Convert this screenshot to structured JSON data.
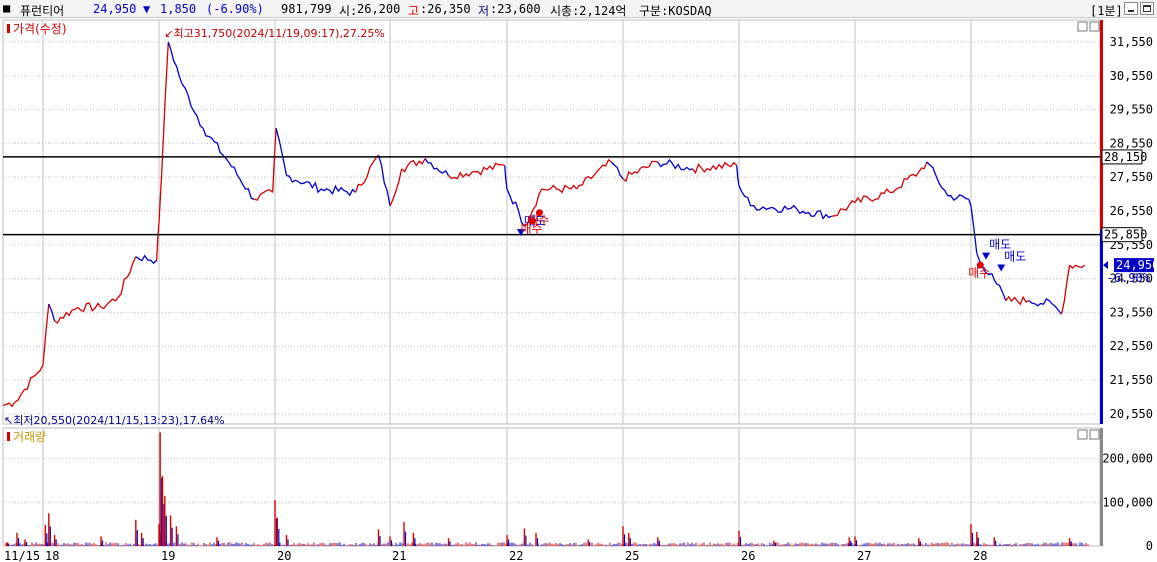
{
  "header": {
    "name": "퓨런티어",
    "price": "24,950",
    "change_arrow": "▼",
    "change": "1,850",
    "change_pct": "(-6.90%)",
    "volume": "981,799",
    "open_label": "시:",
    "open": "26,200",
    "high_label": "고",
    "high": ":26,350",
    "low_label": "저",
    "low": ":23,600",
    "mcap": "시총:2,124억",
    "market": "구분:KOSDAQ",
    "interval": "[1분]"
  },
  "colors": {
    "up": "#d40000",
    "down": "#0000c8",
    "grid": "#c0c0c0",
    "hline": "#000000"
  },
  "chart_data": [
    {
      "type": "line",
      "title": "가격(수정)",
      "x_labels": [
        "11/15",
        "18",
        "19",
        "20",
        "21",
        "22",
        "25",
        "26",
        "27",
        "28"
      ],
      "y_ticks": [
        31550,
        30550,
        29550,
        28550,
        27550,
        26550,
        25550,
        24550,
        23550,
        22550,
        21550,
        20550
      ],
      "ylim": [
        20250,
        32200
      ],
      "series": [
        {
          "x": [
            0,
            0.3,
            1.0,
            1.05,
            1.1,
            1.3,
            1.5,
            1.65,
            1.8,
            1.98,
            2.0,
            2.08,
            2.2,
            2.38,
            2.6,
            2.82,
            2.98,
            3.01,
            3.1,
            3.4,
            3.7,
            3.9,
            4.0,
            4.1,
            4.3,
            4.5,
            4.7,
            4.98,
            5.0,
            5.1,
            5.15,
            5.3,
            5.6,
            5.9,
            6.0,
            6.3,
            6.6,
            6.98,
            7.0,
            7.1,
            7.5,
            7.8,
            8.0,
            8.3,
            8.55,
            8.62,
            8.8,
            8.98,
            9.0,
            9.05,
            9.1,
            9.18,
            9.22,
            9.3,
            9.5,
            9.7,
            9.78,
            9.85,
            9.98
          ],
          "values": [
            20800,
            20900,
            22000,
            23800,
            23300,
            23700,
            23700,
            24000,
            25200,
            25100,
            26200,
            31550,
            30300,
            29000,
            28000,
            26900,
            27100,
            29000,
            27600,
            27200,
            27100,
            28200,
            26700,
            27800,
            28100,
            27600,
            27700,
            27900,
            27200,
            26550,
            26100,
            27200,
            27200,
            28000,
            27500,
            28000,
            27800,
            27900,
            27300,
            26700,
            26600,
            26400,
            26800,
            27100,
            27700,
            28000,
            27000,
            26900,
            26700,
            25300,
            24900,
            24700,
            24400,
            23900,
            23900,
            23800,
            23500,
            24950,
            24950
          ]
        }
      ],
      "hlines": [
        {
          "value": 28150,
          "label": "28,150"
        },
        {
          "value": 25850,
          "label": "25,850"
        }
      ],
      "current": {
        "value": 24950,
        "label": "24,950",
        "pct": "-6.90%"
      },
      "annotations": {
        "high": "최고31,750(2024/11/19,09:17),27.25%",
        "low": "최저20,550(2024/11/15,13:23),17.64%"
      },
      "signals": [
        {
          "x": 5.12,
          "value": 25900,
          "text": "매도",
          "kind": "sell"
        },
        {
          "x": 5.22,
          "value": 26250,
          "text": "매수",
          "kind": "buy"
        },
        {
          "x": 5.28,
          "value": 26500,
          "text": "매수",
          "kind": "buy"
        },
        {
          "x": 9.08,
          "value": 24950,
          "text": "매수",
          "kind": "buy"
        },
        {
          "x": 9.13,
          "value": 25200,
          "text": "매도",
          "kind": "sell"
        },
        {
          "x": 9.26,
          "value": 24850,
          "text": "매도",
          "kind": "sell"
        }
      ]
    },
    {
      "type": "bar",
      "title": "거래량",
      "y_ticks": [
        0,
        100000,
        200000
      ],
      "y_tick_labels": [
        "0",
        "100,000",
        "200,000"
      ],
      "ylim": [
        0,
        270000
      ],
      "spikes": [
        {
          "x": 0.1,
          "value": 8000
        },
        {
          "x": 0.35,
          "value": 30000
        },
        {
          "x": 0.55,
          "value": 15000
        },
        {
          "x": 1.02,
          "value": 48000
        },
        {
          "x": 1.05,
          "value": 75000
        },
        {
          "x": 1.1,
          "value": 25000
        },
        {
          "x": 1.5,
          "value": 22000
        },
        {
          "x": 1.8,
          "value": 60000
        },
        {
          "x": 1.85,
          "value": 30000
        },
        {
          "x": 2.0,
          "value": 50000
        },
        {
          "x": 2.01,
          "value": 260000
        },
        {
          "x": 2.03,
          "value": 160000
        },
        {
          "x": 2.05,
          "value": 115000
        },
        {
          "x": 2.1,
          "value": 70000
        },
        {
          "x": 2.15,
          "value": 45000
        },
        {
          "x": 2.5,
          "value": 20000
        },
        {
          "x": 3.0,
          "value": 105000
        },
        {
          "x": 3.02,
          "value": 65000
        },
        {
          "x": 3.1,
          "value": 25000
        },
        {
          "x": 3.9,
          "value": 38000
        },
        {
          "x": 4.0,
          "value": 22000
        },
        {
          "x": 4.12,
          "value": 55000
        },
        {
          "x": 4.2,
          "value": 30000
        },
        {
          "x": 4.5,
          "value": 18000
        },
        {
          "x": 5.0,
          "value": 25000
        },
        {
          "x": 5.15,
          "value": 40000
        },
        {
          "x": 5.25,
          "value": 30000
        },
        {
          "x": 5.7,
          "value": 15000
        },
        {
          "x": 6.0,
          "value": 45000
        },
        {
          "x": 6.05,
          "value": 30000
        },
        {
          "x": 6.3,
          "value": 20000
        },
        {
          "x": 7.0,
          "value": 35000
        },
        {
          "x": 7.3,
          "value": 12000
        },
        {
          "x": 7.95,
          "value": 20000
        },
        {
          "x": 8.0,
          "value": 22000
        },
        {
          "x": 8.55,
          "value": 18000
        },
        {
          "x": 9.0,
          "value": 50000
        },
        {
          "x": 9.05,
          "value": 32000
        },
        {
          "x": 9.2,
          "value": 20000
        },
        {
          "x": 9.85,
          "value": 18000
        }
      ]
    }
  ]
}
